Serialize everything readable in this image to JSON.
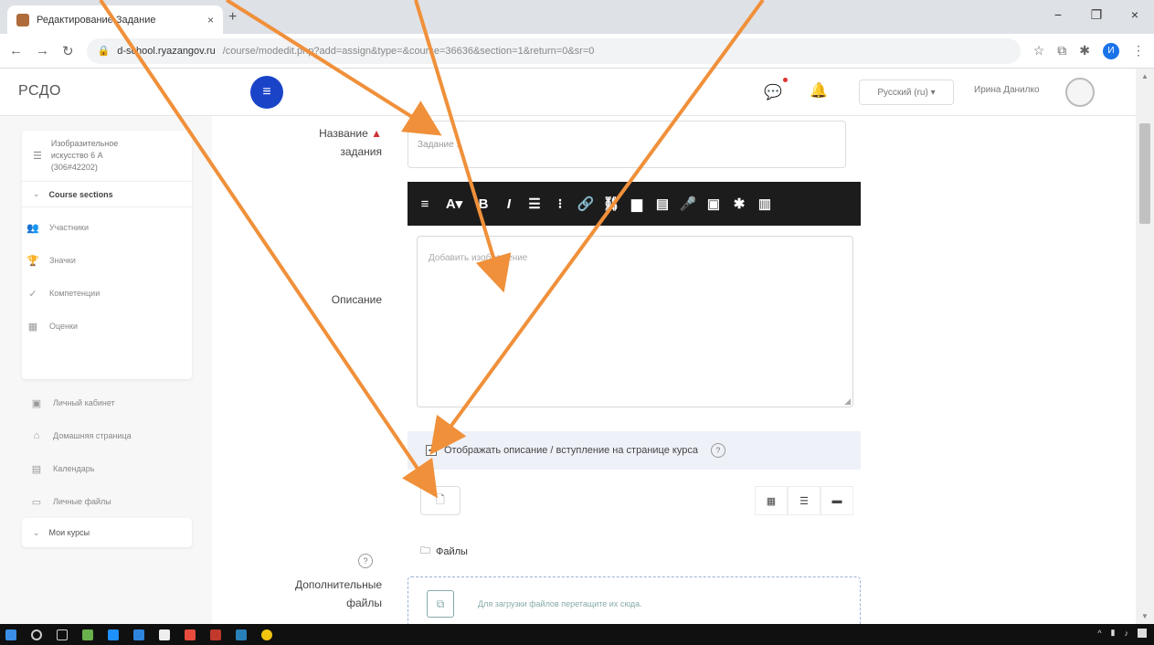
{
  "browser": {
    "tab_title": "Редактирование Задание",
    "tab_close": "×",
    "new_tab": "+",
    "win_min": "−",
    "win_max": "❐",
    "win_close": "×",
    "url_host": "d-school.ryazangov.ru",
    "url_rest": "/course/modedit.php?add=assign&type=&course=36636&section=1&return=0&sr=0",
    "profile_initial": "И"
  },
  "topnav": {
    "brand": "РСДО",
    "language": "Русский (ru) ▾",
    "user_name": "Ирина Данилко"
  },
  "drawer": {
    "course_name": "Изобразительное\nискусство 6 А\n(306#42202)",
    "sections_label": "Course sections",
    "card_items": [
      {
        "icon": "users-icon",
        "glyph": "👥",
        "label": "Участники"
      },
      {
        "icon": "trophy-icon",
        "glyph": "🏆",
        "label": "Значки"
      },
      {
        "icon": "check-icon",
        "glyph": "✓",
        "label": "Компетенции"
      },
      {
        "icon": "grid-icon",
        "glyph": "▦",
        "label": "Оценки"
      }
    ],
    "nav_items": [
      {
        "icon": "dashboard-icon",
        "glyph": "▣",
        "label": "Личный кабинет"
      },
      {
        "icon": "home-icon",
        "glyph": "⌂",
        "label": "Домашняя страница"
      },
      {
        "icon": "calendar-icon",
        "glyph": "▤",
        "label": "Календарь"
      },
      {
        "icon": "files-icon",
        "glyph": "▭",
        "label": "Личные файлы"
      }
    ],
    "my_courses": "Мои курсы"
  },
  "form": {
    "name_label": "Название",
    "name_label2": "задания",
    "name_value": "Задание 1",
    "description_label": "Описание",
    "editor_placeholder": "Добавить изображение",
    "checkbox_label": "Отображать описание / вступление на странице курса",
    "checkbox_checked": true,
    "files_folder": "Файлы",
    "extra_files_label": "Дополнительные",
    "extra_files_label2": "файлы",
    "dropzone_text": "Для загрузки файлов перетащите их сюда."
  },
  "toolbar": [
    {
      "name": "menu-toggle-icon",
      "glyph": "≡"
    },
    {
      "name": "font-style-icon",
      "glyph": "A▾"
    },
    {
      "name": "bold-icon",
      "glyph": "B"
    },
    {
      "name": "italic-icon",
      "glyph": "I"
    },
    {
      "name": "bullet-list-icon",
      "glyph": "☰"
    },
    {
      "name": "numbered-list-icon",
      "glyph": "⁝"
    },
    {
      "name": "link-icon",
      "glyph": "🔗"
    },
    {
      "name": "unlink-icon",
      "glyph": "⛓"
    },
    {
      "name": "image-icon",
      "glyph": "▆"
    },
    {
      "name": "media-icon",
      "glyph": "▤"
    },
    {
      "name": "record-audio-icon",
      "glyph": "🎤"
    },
    {
      "name": "record-video-icon",
      "glyph": "▣"
    },
    {
      "name": "manage-files-icon",
      "glyph": "✱"
    },
    {
      "name": "h5p-icon",
      "glyph": "▥"
    }
  ],
  "colors": {
    "accent": "#1a44c8",
    "arrow": "#f0903a",
    "required": "#cc3333"
  }
}
